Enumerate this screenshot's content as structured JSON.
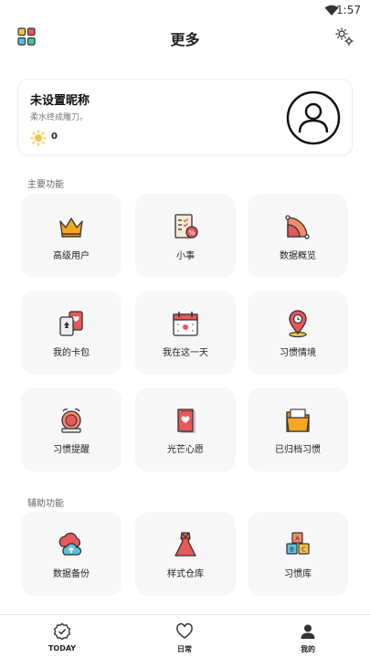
{
  "status": {
    "time": "1:57"
  },
  "header": {
    "title": "更多"
  },
  "profile": {
    "nickname": "未设置昵称",
    "motto": "柔水终成雕刀。",
    "sun_count": "0"
  },
  "sections": {
    "main": {
      "label": "主要功能"
    },
    "aux": {
      "label": "辅助功能"
    }
  },
  "features": [
    {
      "label": "高级用户",
      "icon": "crown-icon"
    },
    {
      "label": "小事",
      "icon": "checklist-icon"
    },
    {
      "label": "数据概览",
      "icon": "pie-chart-icon"
    },
    {
      "label": "我的卡包",
      "icon": "cards-icon"
    },
    {
      "label": "我在这一天",
      "icon": "calendar-icon"
    },
    {
      "label": "习惯情境",
      "icon": "location-pin-icon"
    },
    {
      "label": "习惯提醒",
      "icon": "alarm-bell-icon"
    },
    {
      "label": "光芒心愿",
      "icon": "wish-card-icon"
    },
    {
      "label": "已归档习惯",
      "icon": "archive-folder-icon"
    }
  ],
  "aux_features": [
    {
      "label": "数据备份",
      "icon": "cloud-backup-icon"
    },
    {
      "label": "样式仓库",
      "icon": "dress-icon"
    },
    {
      "label": "习惯库",
      "icon": "abc-blocks-icon"
    }
  ],
  "nav": [
    {
      "label": "TODAY",
      "icon": "check-badge-icon"
    },
    {
      "label": "日常",
      "icon": "heart-icon"
    },
    {
      "label": "我的",
      "icon": "person-icon"
    }
  ],
  "colors": {
    "accent_orange": "#F5A623",
    "accent_red": "#E8575A",
    "tile_bg": "#F7F7F7"
  }
}
